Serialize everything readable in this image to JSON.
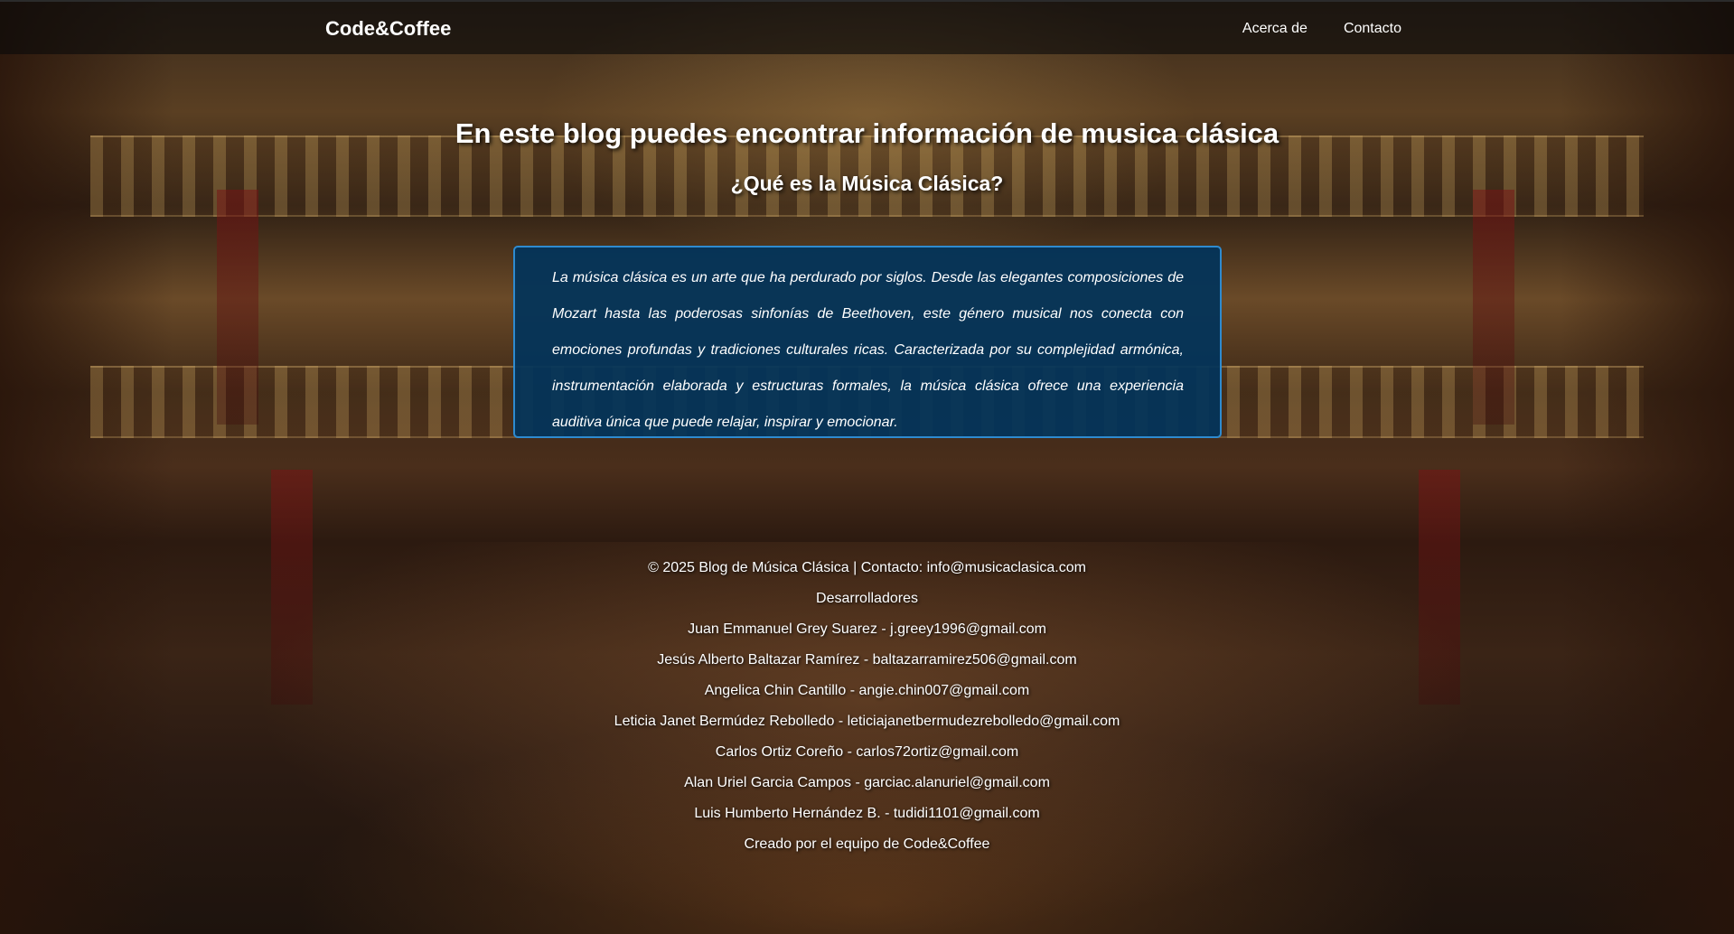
{
  "navbar": {
    "brand": "Code&Coffee",
    "links": [
      "Acerca de",
      "Contacto"
    ]
  },
  "hero": {
    "title": "En este blog puedes encontrar información de musica clásica",
    "subtitle": "¿Qué es la Música Clásica?"
  },
  "info": {
    "text": "La música clásica es un arte que ha perdurado por siglos. Desde las elegantes composiciones de Mozart hasta las poderosas sinfonías de Beethoven, este género musical nos conecta con emociones profundas y tradiciones culturales ricas. Caracterizada por su complejidad armónica, instrumentación elaborada y estructuras formales, la música clásica ofrece una experiencia auditiva única que puede relajar, inspirar y emocionar."
  },
  "footer": {
    "copyright": "© 2025 Blog de Música Clásica | Contacto: info@musicaclasica.com",
    "developers_heading": "Desarrolladores",
    "developers": [
      "Juan Emmanuel Grey Suarez - j.greey1996@gmail.com",
      "Jesús Alberto Baltazar Ramírez - baltazarramirez506@gmail.com",
      "Angelica Chin Cantillo - angie.chin007@gmail.com",
      "Leticia Janet Bermúdez Rebolledo - leticiajanetbermudezrebolledo@gmail.com",
      "Carlos Ortiz Coreño - carlos72ortiz@gmail.com",
      "Alan Uriel Garcia Campos - garciac.alanuriel@gmail.com",
      "Luis Humberto Hernández B. - tudidi1101@gmail.com"
    ],
    "credit": "Creado por el equipo de Code&Coffee"
  }
}
